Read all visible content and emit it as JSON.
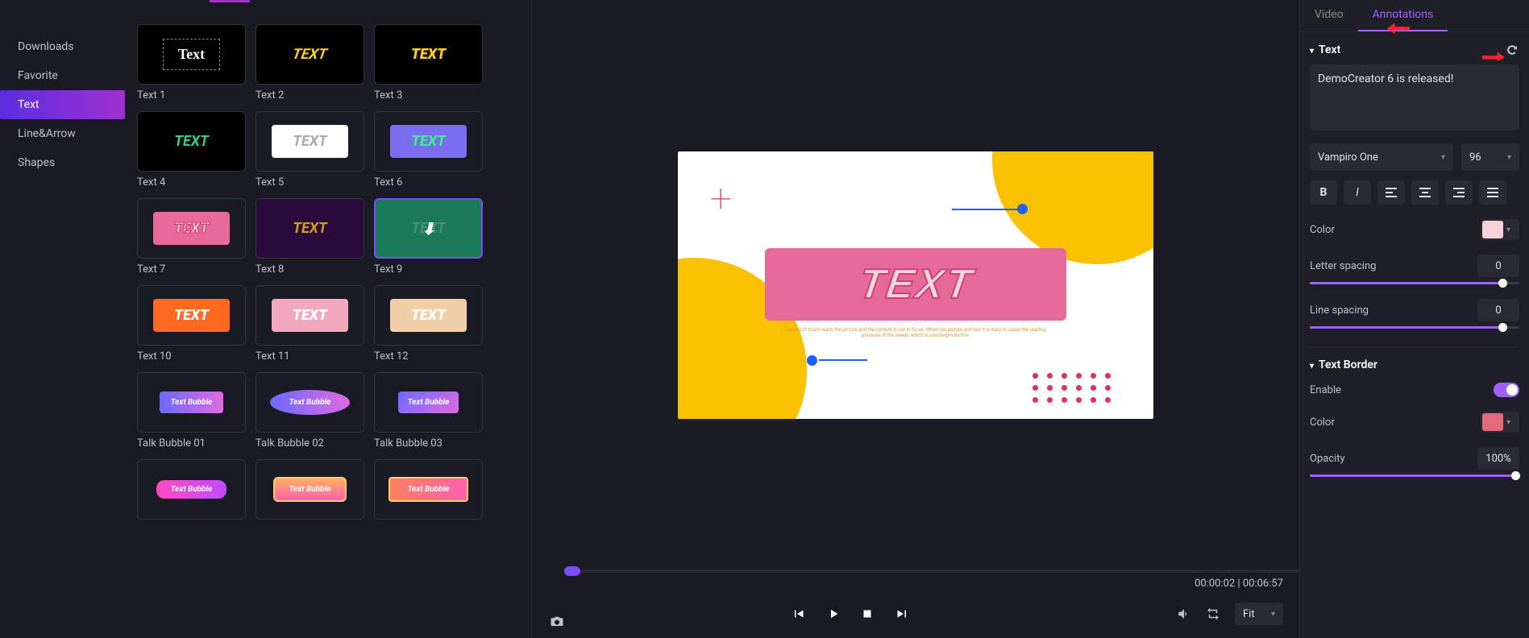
{
  "sidebar": {
    "items": [
      {
        "label": "Downloads"
      },
      {
        "label": "Favorite"
      },
      {
        "label": "Text"
      },
      {
        "label": "Line&Arrow"
      },
      {
        "label": "Shapes"
      }
    ]
  },
  "assets": [
    {
      "label": "Text 1"
    },
    {
      "label": "Text 2"
    },
    {
      "label": "Text 3"
    },
    {
      "label": "Text 4"
    },
    {
      "label": "Text 5"
    },
    {
      "label": "Text 6"
    },
    {
      "label": "Text 7"
    },
    {
      "label": "Text 8"
    },
    {
      "label": "Text 9"
    },
    {
      "label": "Text 10"
    },
    {
      "label": "Text 11"
    },
    {
      "label": "Text 12"
    },
    {
      "label": "Talk Bubble 01"
    },
    {
      "label": "Talk Bubble 02"
    },
    {
      "label": "Talk Bubble 03"
    }
  ],
  "asset_text": "TEXT",
  "asset_text_serif": "Text",
  "bubble_text": "Text Bubble",
  "canvas": {
    "text": "TEXT",
    "subtext": "Too much touch reads the picture and the content is not in focus. When too picture and text it is easy to cause the reading pressure of the viewer, which is counterproductive."
  },
  "playbar": {
    "current": "00:00:02",
    "total": "00:06:57",
    "fit": "Fit"
  },
  "right": {
    "tabs": {
      "video": "Video",
      "annotations": "Annotations"
    },
    "text_section": "Text",
    "text_value": "DemoCreator 6 is released!",
    "font": "Vampiro One",
    "font_size": "96",
    "color_label": "Color",
    "color_value": "#f8d0d8",
    "letter_spacing_label": "Letter spacing",
    "letter_spacing_value": "0",
    "line_spacing_label": "Line spacing",
    "line_spacing_value": "0",
    "border_section": "Text Border",
    "enable_label": "Enable",
    "border_color_value": "#e56a7a",
    "opacity_label": "Opacity",
    "opacity_value": "100%"
  }
}
